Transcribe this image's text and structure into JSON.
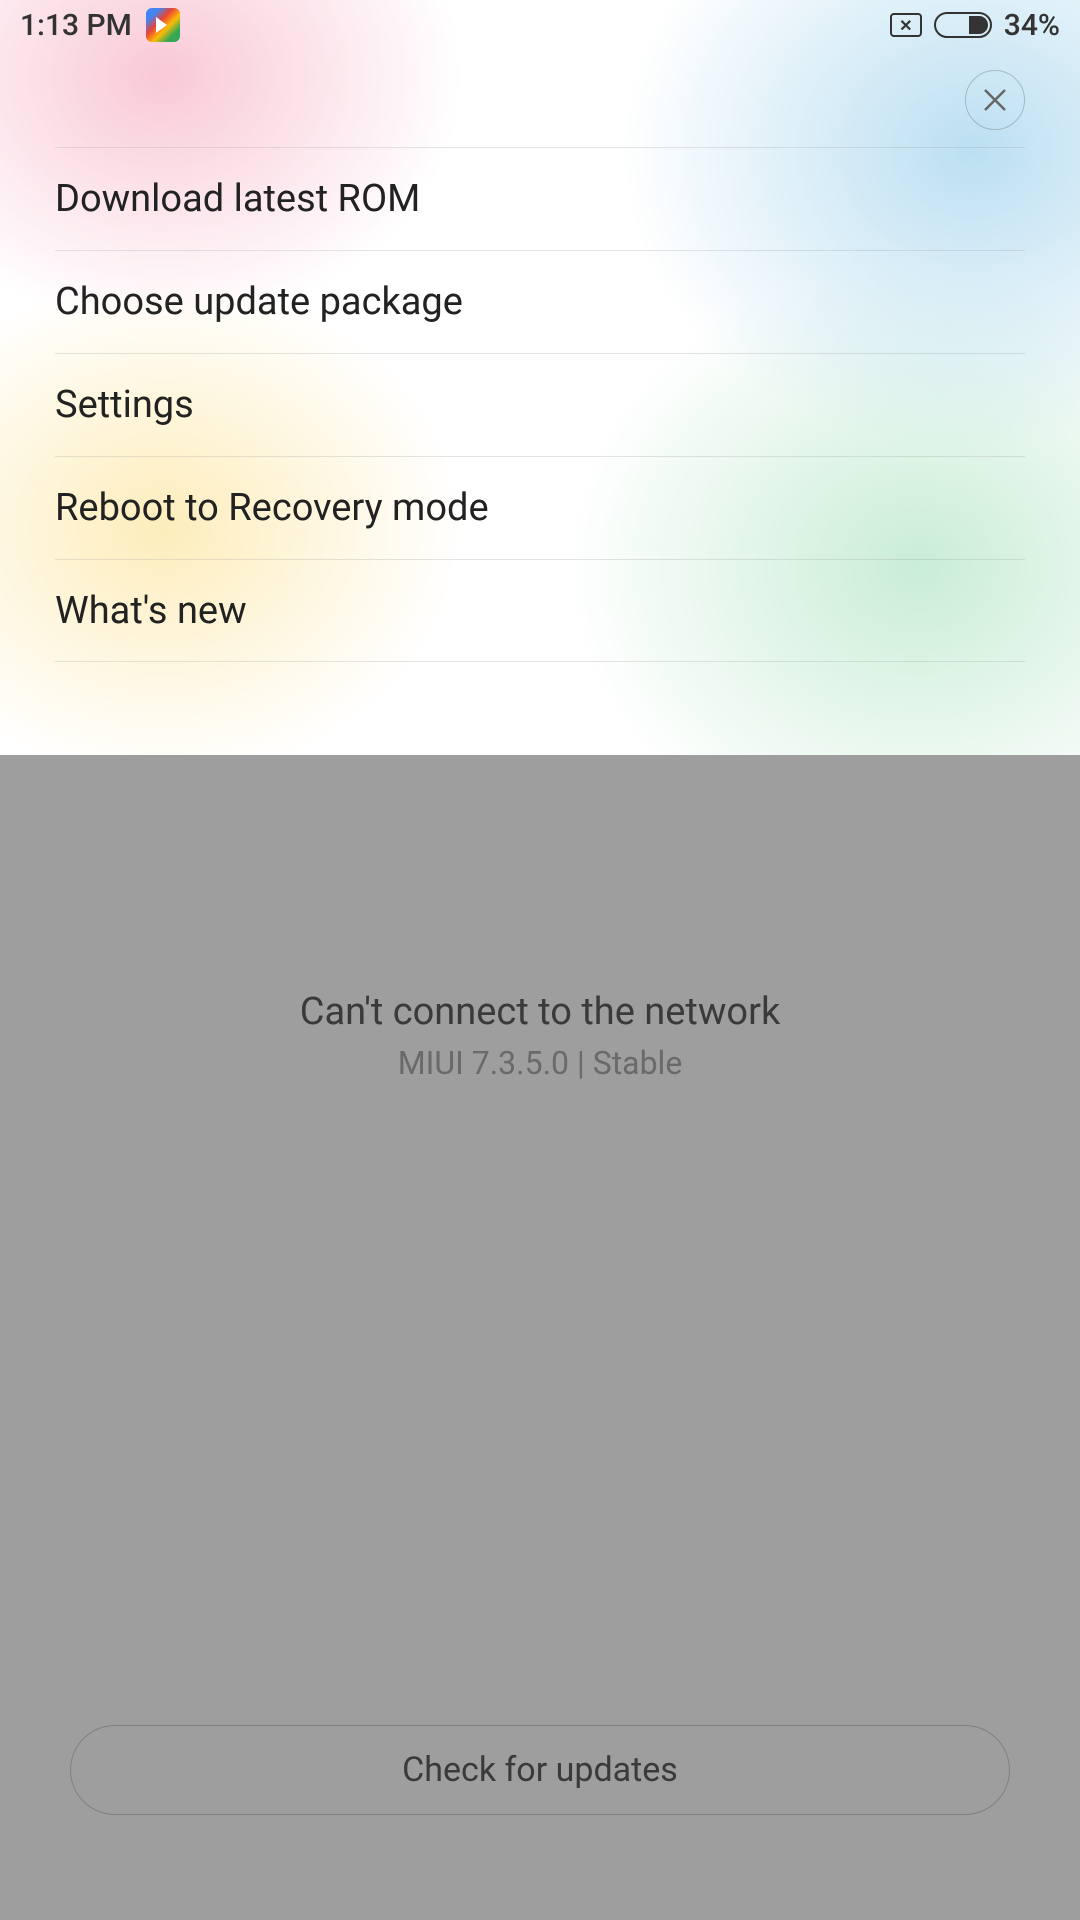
{
  "status_bar": {
    "time": "1:13 PM",
    "battery_percent": "34%"
  },
  "menu": {
    "items": [
      {
        "label": "Download latest ROM"
      },
      {
        "label": "Choose update package"
      },
      {
        "label": "Settings"
      },
      {
        "label": "Reboot to Recovery mode"
      },
      {
        "label": "What's new"
      }
    ]
  },
  "main": {
    "error_message": "Can't connect to the network",
    "version": "MIUI 7.3.5.0 | Stable",
    "check_button": "Check for updates"
  }
}
